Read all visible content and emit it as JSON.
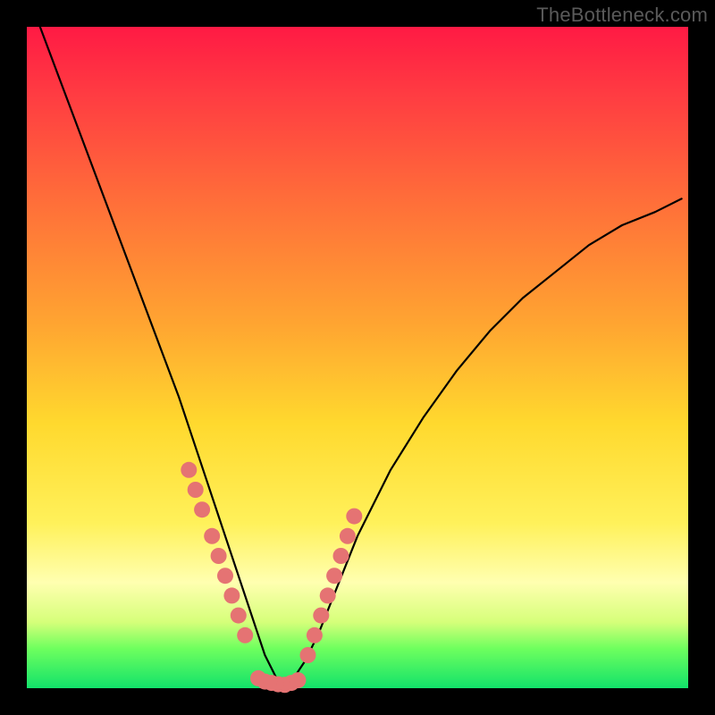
{
  "watermark": "TheBottleneck.com",
  "colors": {
    "curve_stroke": "#000000",
    "marker_fill": "#e57373",
    "frame_bg": "#000000"
  },
  "chart_data": {
    "type": "line",
    "title": "",
    "xlabel": "",
    "ylabel": "",
    "xlim": [
      0,
      100
    ],
    "ylim": [
      0,
      100
    ],
    "grid": false,
    "legend": false,
    "series": [
      {
        "name": "bottleneck-curve",
        "x": [
          2,
          5,
          8,
          11,
          14,
          17,
          20,
          23,
          25,
          27,
          29,
          31,
          33,
          34,
          35,
          36,
          37,
          38,
          39,
          40,
          42,
          44,
          46,
          48,
          50,
          55,
          60,
          65,
          70,
          75,
          80,
          85,
          90,
          95,
          99
        ],
        "y": [
          100,
          92,
          84,
          76,
          68,
          60,
          52,
          44,
          38,
          32,
          26,
          20,
          14,
          11,
          8,
          5,
          3,
          1,
          0,
          1,
          4,
          8,
          13,
          18,
          23,
          33,
          41,
          48,
          54,
          59,
          63,
          67,
          70,
          72,
          74
        ]
      }
    ],
    "markers": [
      {
        "name": "left-cluster",
        "x_range": [
          24,
          33
        ],
        "y_range": [
          10,
          32
        ]
      },
      {
        "name": "valley-floor",
        "x_range": [
          35,
          41
        ],
        "y_range": [
          0,
          3
        ]
      },
      {
        "name": "right-cluster",
        "x_range": [
          42,
          50
        ],
        "y_range": [
          5,
          26
        ]
      }
    ],
    "marker_points": [
      {
        "x": 24.5,
        "y": 33
      },
      {
        "x": 25.5,
        "y": 30
      },
      {
        "x": 26.5,
        "y": 27
      },
      {
        "x": 28.0,
        "y": 23
      },
      {
        "x": 29.0,
        "y": 20
      },
      {
        "x": 30.0,
        "y": 17
      },
      {
        "x": 31.0,
        "y": 14
      },
      {
        "x": 32.0,
        "y": 11
      },
      {
        "x": 33.0,
        "y": 8
      },
      {
        "x": 35.0,
        "y": 1.5
      },
      {
        "x": 36.0,
        "y": 1.0
      },
      {
        "x": 37.0,
        "y": 0.8
      },
      {
        "x": 38.0,
        "y": 0.6
      },
      {
        "x": 39.0,
        "y": 0.5
      },
      {
        "x": 40.0,
        "y": 0.8
      },
      {
        "x": 41.0,
        "y": 1.2
      },
      {
        "x": 42.5,
        "y": 5
      },
      {
        "x": 43.5,
        "y": 8
      },
      {
        "x": 44.5,
        "y": 11
      },
      {
        "x": 45.5,
        "y": 14
      },
      {
        "x": 46.5,
        "y": 17
      },
      {
        "x": 47.5,
        "y": 20
      },
      {
        "x": 48.5,
        "y": 23
      },
      {
        "x": 49.5,
        "y": 26
      }
    ]
  }
}
